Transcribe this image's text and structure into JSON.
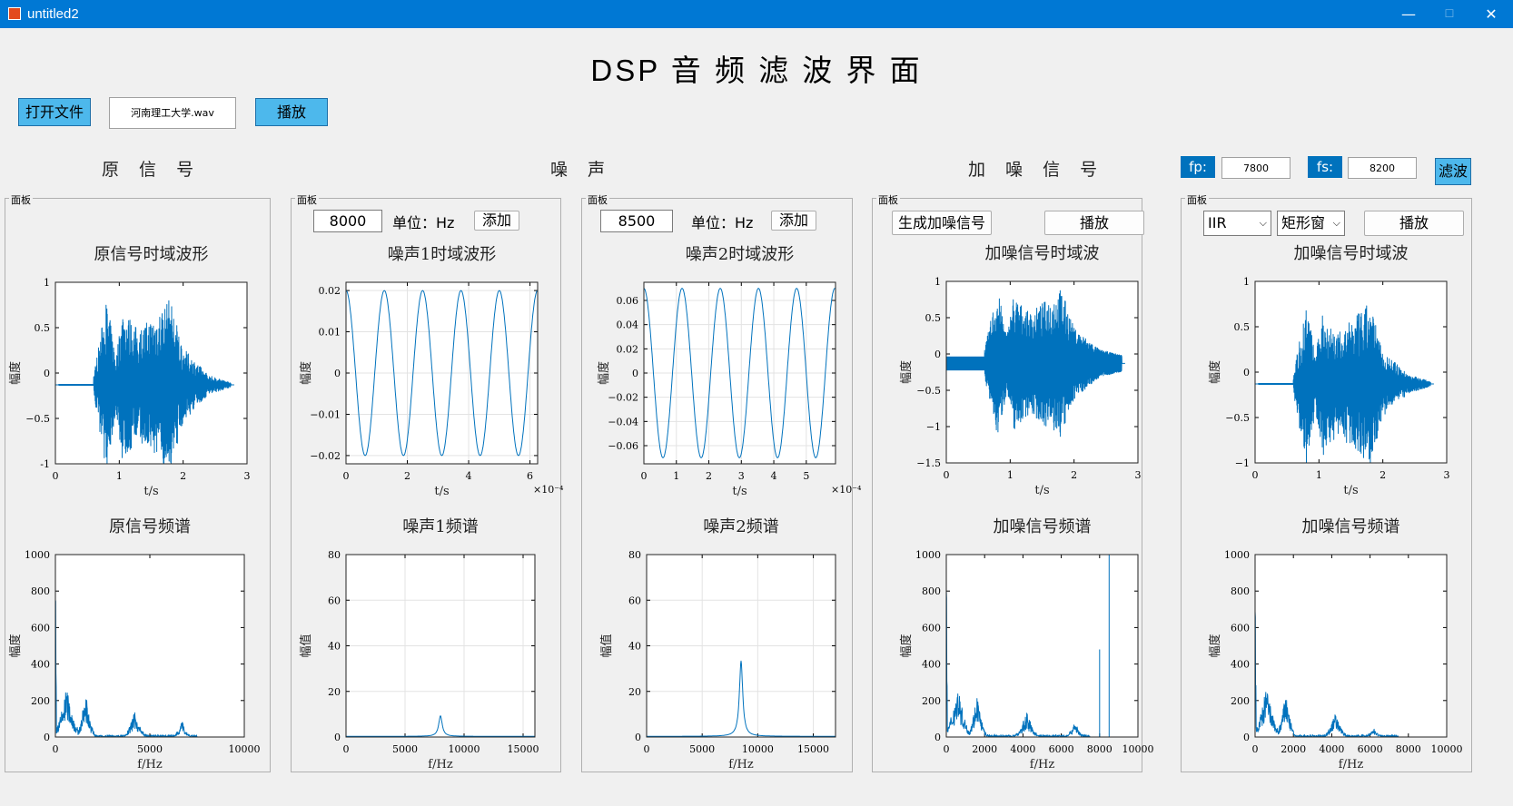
{
  "window": {
    "title": "untitled2",
    "minimize": "—",
    "maximize": "☐",
    "close": "✕"
  },
  "app": {
    "title": "DSP  音 频 滤 波 界 面"
  },
  "toolbar": {
    "open_label": "打开文件",
    "file_name": "河南理工大学.wav",
    "play_label": "播放"
  },
  "sections": {
    "original": "原 信 号",
    "noise": "噪 声",
    "noisy": "加 噪 信 号"
  },
  "filter": {
    "fp_label": "fp:",
    "fp_value": "7800",
    "fs_label": "fs:",
    "fs_value": "8200",
    "button": "滤波"
  },
  "panels": {
    "label": "面板",
    "noise1": {
      "freq": "8000",
      "unit": "单位：Hz",
      "add": "添加"
    },
    "noise2": {
      "freq": "8500",
      "unit": "单位：Hz",
      "add": "添加"
    },
    "noisy": {
      "generate": "生成加噪信号",
      "play": "播放"
    },
    "filtered": {
      "type_selected": "IIR",
      "window_selected": "矩形窗",
      "play": "播放"
    }
  },
  "colors": {
    "line": "#0072bd",
    "badge": "#0072bd",
    "button": "#4db8ec",
    "titlebar": "#0078d4"
  },
  "chart_data": [
    {
      "id": "orig-time",
      "type": "line",
      "title": "原信号时域波形",
      "xlabel": "t/s",
      "ylabel": "幅度",
      "xlim": [
        0,
        3
      ],
      "ylim": [
        -1,
        1
      ],
      "xticks": [
        "0",
        "1",
        "2",
        "3"
      ],
      "yticks": [
        "-1",
        "−0.5",
        "0",
        "0.5",
        "1"
      ],
      "grid": false,
      "signal": "speech",
      "offset": -0.13,
      "envelope": [
        [
          0.6,
          0.1
        ],
        [
          0.8,
          0.95
        ],
        [
          0.95,
          0.3
        ],
        [
          1.05,
          0.85
        ],
        [
          1.3,
          0.6
        ],
        [
          1.8,
          0.95
        ],
        [
          2.0,
          0.4
        ],
        [
          2.4,
          0.1
        ],
        [
          2.75,
          0.02
        ]
      ]
    },
    {
      "id": "noise1-time",
      "type": "line",
      "title": "噪声1时域波形",
      "xlabel": "t/s",
      "ylabel": "幅度",
      "xlim": [
        0,
        6.25
      ],
      "ylim": [
        -0.022,
        0.022
      ],
      "xticks": [
        "0",
        "2",
        "4",
        "6"
      ],
      "yticks": [
        "−0.02",
        "−0.01",
        "0",
        "0.01",
        "0.02"
      ],
      "exponent": "×10⁻⁴",
      "grid": true,
      "signal": "cosine",
      "amplitude": 0.02,
      "period": 1.25
    },
    {
      "id": "noise2-time",
      "type": "line",
      "title": "噪声2时域波形",
      "xlabel": "t/s",
      "ylabel": "幅度",
      "xlim": [
        0,
        5.9
      ],
      "ylim": [
        -0.075,
        0.075
      ],
      "xticks": [
        "0",
        "1",
        "2",
        "3",
        "4",
        "5"
      ],
      "yticks": [
        "−0.06",
        "−0.04",
        "−0.02",
        "0",
        "0.02",
        "0.04",
        "0.06"
      ],
      "exponent": "×10⁻⁴",
      "grid": true,
      "signal": "cosine",
      "amplitude": 0.07,
      "period": 1.176
    },
    {
      "id": "noisy-time",
      "type": "line",
      "title": "加噪信号时域波",
      "xlabel": "t/s",
      "ylabel": "幅度",
      "xlim": [
        0,
        3
      ],
      "ylim": [
        -1.5,
        1
      ],
      "xticks": [
        "0",
        "1",
        "2",
        "3"
      ],
      "yticks": [
        "−1.5",
        "−1",
        "−0.5",
        "0",
        "0.5",
        "1"
      ],
      "grid": false,
      "signal": "speech-noise",
      "offset": -0.13,
      "noise_band": 0.09,
      "envelope": [
        [
          0.6,
          0.1
        ],
        [
          0.8,
          0.95
        ],
        [
          0.95,
          0.3
        ],
        [
          1.05,
          0.85
        ],
        [
          1.3,
          0.6
        ],
        [
          1.8,
          0.95
        ],
        [
          2.0,
          0.4
        ],
        [
          2.4,
          0.1
        ],
        [
          2.75,
          0.02
        ]
      ]
    },
    {
      "id": "filtered-time",
      "type": "line",
      "title": "加噪信号时域波",
      "xlabel": "t/s",
      "ylabel": "幅度",
      "xlim": [
        0,
        3
      ],
      "ylim": [
        -1,
        1
      ],
      "xticks": [
        "0",
        "1",
        "2",
        "3"
      ],
      "yticks": [
        "−1",
        "−0.5",
        "0",
        "0.5",
        "1"
      ],
      "grid": false,
      "signal": "speech",
      "offset": -0.13,
      "envelope": [
        [
          0.6,
          0.1
        ],
        [
          0.8,
          0.9
        ],
        [
          0.95,
          0.3
        ],
        [
          1.05,
          0.8
        ],
        [
          1.3,
          0.55
        ],
        [
          1.8,
          0.9
        ],
        [
          2.0,
          0.35
        ],
        [
          2.4,
          0.1
        ],
        [
          2.75,
          0.02
        ]
      ]
    },
    {
      "id": "orig-spec",
      "type": "line",
      "title": "原信号频谱",
      "xlabel": "f/Hz",
      "ylabel": "幅度",
      "xlim": [
        0,
        10000
      ],
      "ylim": [
        0,
        1000
      ],
      "xticks": [
        "0",
        "5000",
        "10000"
      ],
      "yticks": [
        "0",
        "200",
        "400",
        "600",
        "800",
        "1000"
      ],
      "grid": false,
      "signal": "speech-spectrum",
      "peaks": [
        [
          0,
          1000
        ],
        [
          600,
          270
        ],
        [
          1600,
          240
        ],
        [
          4200,
          130
        ],
        [
          6700,
          80
        ]
      ]
    },
    {
      "id": "noise1-spec",
      "type": "line",
      "title": "噪声1频谱",
      "xlabel": "f/Hz",
      "ylabel": "幅值",
      "xlim": [
        0,
        16000
      ],
      "ylim": [
        0,
        80
      ],
      "xticks": [
        "0",
        "5000",
        "10000",
        "15000"
      ],
      "yticks": [
        "0",
        "20",
        "40",
        "60",
        "80"
      ],
      "grid": true,
      "signal": "peak",
      "peak_x": 8000,
      "peak_y": 9
    },
    {
      "id": "noise2-spec",
      "type": "line",
      "title": "噪声2频谱",
      "xlabel": "f/Hz",
      "ylabel": "幅值",
      "xlim": [
        0,
        17000
      ],
      "ylim": [
        0,
        80
      ],
      "xticks": [
        "0",
        "5000",
        "10000",
        "15000"
      ],
      "yticks": [
        "0",
        "20",
        "40",
        "60",
        "80"
      ],
      "grid": true,
      "signal": "peak",
      "peak_x": 8500,
      "peak_y": 33
    },
    {
      "id": "noisy-spec",
      "type": "line",
      "title": "加噪信号频谱",
      "xlabel": "f/Hz",
      "ylabel": "幅度",
      "xlim": [
        0,
        10000
      ],
      "ylim": [
        0,
        1000
      ],
      "xticks": [
        "0",
        "2000",
        "4000",
        "6000",
        "8000",
        "10000"
      ],
      "yticks": [
        "0",
        "200",
        "400",
        "600",
        "800",
        "1000"
      ],
      "grid": false,
      "signal": "speech-spectrum",
      "peaks": [
        [
          0,
          1000
        ],
        [
          600,
          270
        ],
        [
          1600,
          240
        ],
        [
          4200,
          130
        ],
        [
          6700,
          80
        ]
      ],
      "spikes": [
        [
          8000,
          480
        ],
        [
          8500,
          1000
        ]
      ]
    },
    {
      "id": "filtered-spec",
      "type": "line",
      "title": "加噪信号频谱",
      "xlabel": "f/Hz",
      "ylabel": "幅度",
      "xlim": [
        0,
        10000
      ],
      "ylim": [
        0,
        1000
      ],
      "xticks": [
        "0",
        "2000",
        "4000",
        "6000",
        "8000",
        "10000"
      ],
      "yticks": [
        "0",
        "200",
        "400",
        "600",
        "800",
        "1000"
      ],
      "grid": false,
      "signal": "speech-spectrum",
      "peaks": [
        [
          0,
          1000
        ],
        [
          600,
          270
        ],
        [
          1600,
          240
        ],
        [
          4200,
          130
        ],
        [
          6200,
          40
        ]
      ]
    }
  ]
}
